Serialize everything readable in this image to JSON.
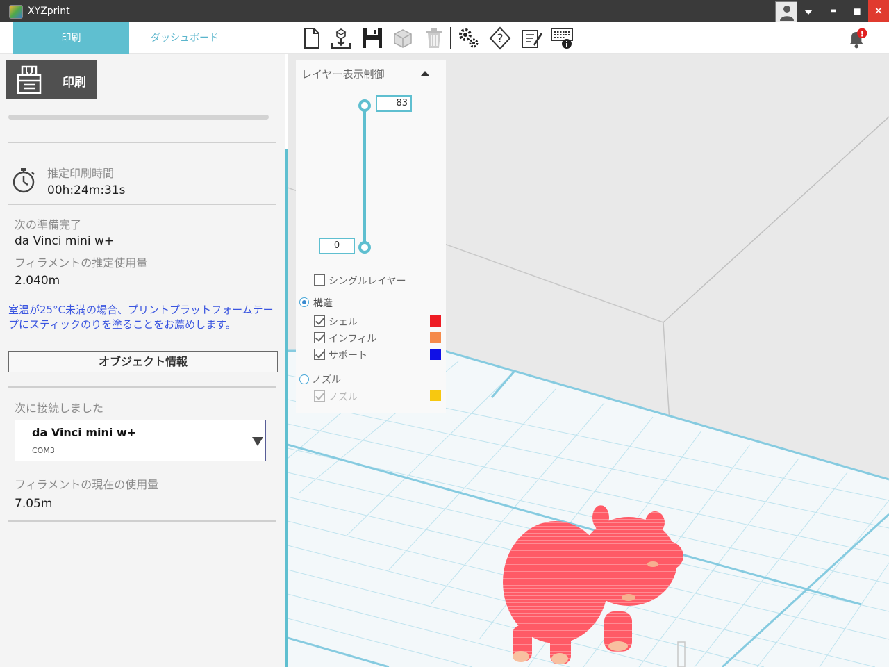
{
  "window": {
    "title": "XYZprint",
    "minimize": "▬",
    "maximize": "■",
    "close": "✕"
  },
  "tabs": [
    {
      "label": "印刷"
    },
    {
      "label": "ダッシュボード"
    }
  ],
  "toolbar_icons": [
    "new-file-icon",
    "import-icon",
    "save-icon",
    "object-box-icon",
    "trash-icon",
    "settings-icon",
    "help-icon",
    "edit-icon",
    "keyboard-info-icon",
    "notification-bell-icon"
  ],
  "print_panel": {
    "print_button": "印刷",
    "estimated_time_label": "推定印刷時間",
    "estimated_time_value": "00h:24m:31s",
    "ready_label": "次の準備完了",
    "ready_value": "da Vinci mini w+",
    "filament_estimate_label": "フィラメントの推定使用量",
    "filament_estimate_value": "2.040m",
    "note": "室温が25°C未満の場合、プリントプラットフォームテープにスティックのりを塗ることをお薦めします。",
    "object_info_button": "オブジェクト情報",
    "connected_label": "次に接続しました",
    "printer_name": "da Vinci mini w+",
    "printer_port": "COM3",
    "filament_current_label": "フィラメントの現在の使用量",
    "filament_current_value": "7.05m"
  },
  "layer_panel": {
    "title": "レイヤー表示制御",
    "top_value": "83",
    "bottom_value": "0",
    "single_layer": "シングルレイヤー",
    "structure": "構造",
    "shell": "シェル",
    "infill": "インフィル",
    "support": "サポート",
    "nozzle_radio": "ノズル",
    "nozzle_check": "ノズル",
    "colors": {
      "shell": "#ee1c24",
      "infill": "#f58a4b",
      "support": "#1010e6",
      "nozzle": "#f7c810"
    }
  },
  "notification_badge": "!",
  "accent_color": "#5fbfd0"
}
